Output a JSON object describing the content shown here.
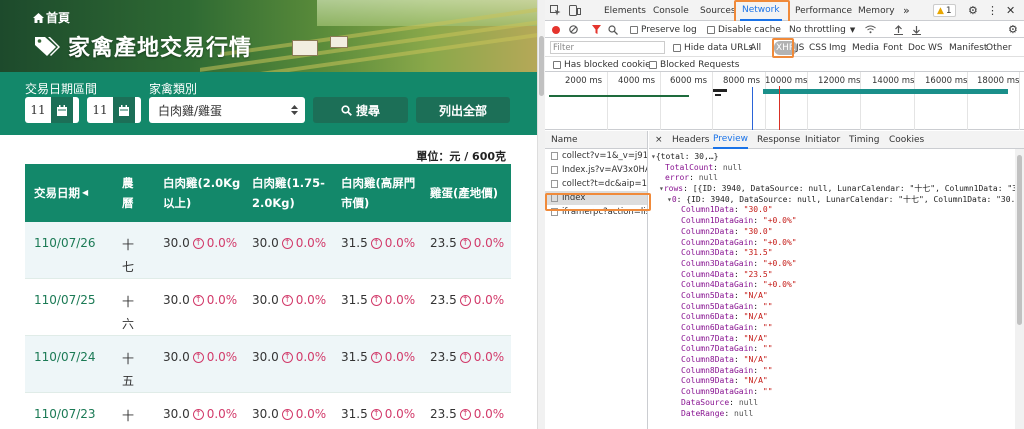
{
  "site": {
    "breadcrumb": "首頁",
    "title": "家禽產地交易行情",
    "filters": {
      "date_range_label": "交易日期區間",
      "start_date": "11",
      "end_date": "11",
      "category_label": "家禽類別",
      "category_value": "白肉雞/雞蛋",
      "search_label": "搜尋",
      "list_all_label": "列出全部"
    },
    "unit": "單位：元 / 600克",
    "table": {
      "headers": {
        "date": "交易日期",
        "lunar": "農曆",
        "c1": "白肉雞(2.0Kg以上)",
        "c2": "白肉雞(1.75-2.0Kg)",
        "c3": "白肉雞(高屏門市價)",
        "c4": "雞蛋(產地價)"
      },
      "rows": [
        {
          "date": "110/07/26",
          "lunar": "十七",
          "v1": "30.0",
          "g1": "0.0%",
          "v2": "30.0",
          "g2": "0.0%",
          "v3": "31.5",
          "g3": "0.0%",
          "v4": "23.5",
          "g4": "0.0%"
        },
        {
          "date": "110/07/25",
          "lunar": "十六",
          "v1": "30.0",
          "g1": "0.0%",
          "v2": "30.0",
          "g2": "0.0%",
          "v3": "31.5",
          "g3": "0.0%",
          "v4": "23.5",
          "g4": "0.0%"
        },
        {
          "date": "110/07/24",
          "lunar": "十五",
          "v1": "30.0",
          "g1": "0.0%",
          "v2": "30.0",
          "g2": "0.0%",
          "v3": "31.5",
          "g3": "0.0%",
          "v4": "23.5",
          "g4": "0.0%"
        },
        {
          "date": "110/07/23",
          "lunar": "十",
          "v1": "30.0",
          "g1": "0.0%",
          "v2": "30.0",
          "g2": "0.0%",
          "v3": "31.5",
          "g3": "0.0%",
          "v4": "23.5",
          "g4": "0.0%"
        }
      ]
    }
  },
  "devtools": {
    "tabs": [
      "Elements",
      "Console",
      "Sources",
      "Network",
      "Performance",
      "Memory"
    ],
    "active_tab": "Network",
    "more_tabs": "»",
    "warning_count": "1",
    "toolbar": {
      "preserve_log": "Preserve log",
      "disable_cache": "Disable cache",
      "throttling": "No throttling"
    },
    "filter": {
      "placeholder": "Filter",
      "hide_data_urls": "Hide data URLs",
      "types": [
        "All",
        "XHR",
        "JS",
        "CSS",
        "Img",
        "Media",
        "Font",
        "Doc",
        "WS",
        "Manifest",
        "Other"
      ],
      "active_type": "XHR",
      "blocked_cookies": "Has blocked cookies",
      "blocked_requests": "Blocked Requests"
    },
    "timeline_ticks": [
      "2000 ms",
      "4000 ms",
      "6000 ms",
      "8000 ms",
      "10000 ms",
      "12000 ms",
      "14000 ms",
      "16000 ms",
      "18000 ms"
    ],
    "name_header": "Name",
    "requests": [
      "collect?v=1&_v=j91...",
      "Index.js?v=AV3x0HA...",
      "collect?t=dc&aip=1...",
      "Index",
      "iframerpc?action=lis..."
    ],
    "selected_request": "Index",
    "panel_tabs": [
      "×",
      "Headers",
      "Preview",
      "Response",
      "Initiator",
      "Timing",
      "Cookies"
    ],
    "active_panel_tab": "Preview",
    "preview": {
      "root": "{total: 30,…}",
      "total_count": "null",
      "error": "null",
      "rows_summary": "[{ID: 3940, DataSource: null, LunarCalendar: \"十七\", Column1Data: \"3",
      "row0_summary": "{ID: 3940, DataSource: null, LunarCalendar: \"十七\", Column1Data: \"30.",
      "fields": [
        {
          "k": "Column1Data",
          "v": "\"30.0\""
        },
        {
          "k": "Column1DataGain",
          "v": "\"+0.0%\""
        },
        {
          "k": "Column2Data",
          "v": "\"30.0\""
        },
        {
          "k": "Column2DataGain",
          "v": "\"+0.0%\""
        },
        {
          "k": "Column3Data",
          "v": "\"31.5\""
        },
        {
          "k": "Column3DataGain",
          "v": "\"+0.0%\""
        },
        {
          "k": "Column4Data",
          "v": "\"23.5\""
        },
        {
          "k": "Column4DataGain",
          "v": "\"+0.0%\""
        },
        {
          "k": "Column5Data",
          "v": "\"N/A\""
        },
        {
          "k": "Column5DataGain",
          "v": "\"\""
        },
        {
          "k": "Column6Data",
          "v": "\"N/A\""
        },
        {
          "k": "Column6DataGain",
          "v": "\"\""
        },
        {
          "k": "Column7Data",
          "v": "\"N/A\""
        },
        {
          "k": "Column7DataGain",
          "v": "\"\""
        },
        {
          "k": "Column8Data",
          "v": "\"N/A\""
        },
        {
          "k": "Column8DataGain",
          "v": "\"\""
        },
        {
          "k": "Column9Data",
          "v": "\"N/A\""
        },
        {
          "k": "Column9DataGain",
          "v": "\"\""
        },
        {
          "k": "DataSource",
          "v": "null"
        },
        {
          "k": "DateRange",
          "v": "null"
        }
      ]
    }
  },
  "colors": {
    "brand_green": "#13886a",
    "button_green": "#1c6f57",
    "gain_red": "#d23a6a",
    "highlight_orange": "#f08a3a"
  }
}
